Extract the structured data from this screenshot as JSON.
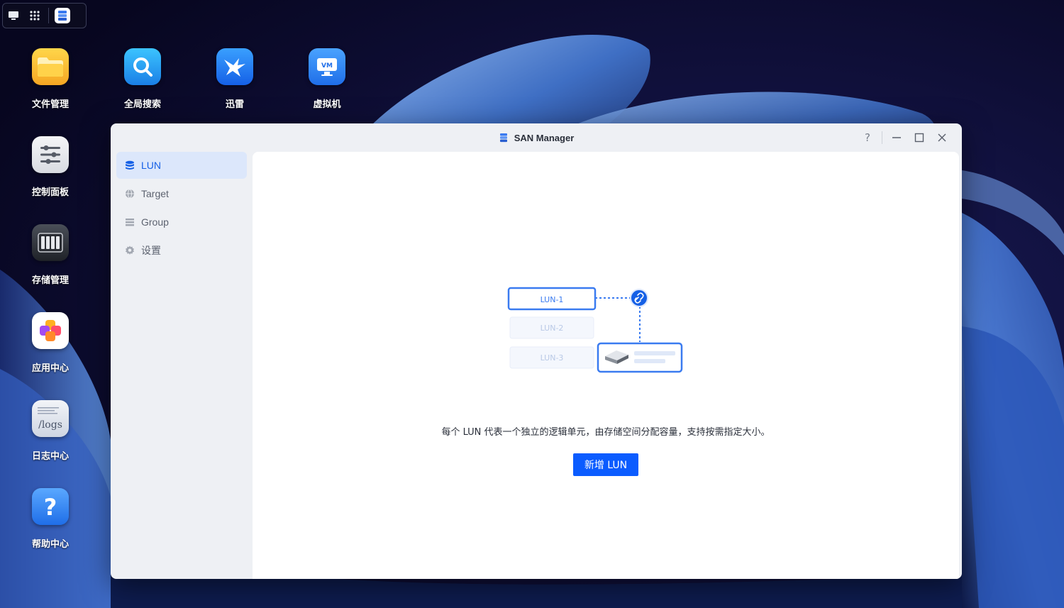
{
  "desktop": {
    "icons": [
      {
        "label": "文件管理"
      },
      {
        "label": "全局搜索"
      },
      {
        "label": "迅雷"
      },
      {
        "label": "虚拟机",
        "badge": "VM"
      },
      {
        "label": "控制面板"
      },
      {
        "label": "存储管理"
      },
      {
        "label": "应用中心"
      },
      {
        "label": "日志中心",
        "badge": "/logs"
      },
      {
        "label": "帮助中心",
        "badge": "?"
      }
    ]
  },
  "taskbar": {
    "items": [
      "desktop-icon",
      "app-grid-icon",
      "san-manager-icon"
    ]
  },
  "window": {
    "title": "SAN Manager",
    "help": "?"
  },
  "sidebar": {
    "items": [
      {
        "label": "LUN",
        "icon": "database-icon",
        "active": true
      },
      {
        "label": "Target",
        "icon": "globe-icon",
        "active": false
      },
      {
        "label": "Group",
        "icon": "list-icon",
        "active": false
      },
      {
        "label": "设置",
        "icon": "gear-icon",
        "active": false
      }
    ]
  },
  "main": {
    "illustration": {
      "lun1": "LUN-1",
      "lun2": "LUN-2",
      "lun3": "LUN-3"
    },
    "description": "每个 LUN 代表一个独立的逻辑单元，由存储空间分配容量，支持按需指定大小。",
    "add_button": "新增 LUN"
  },
  "colors": {
    "accent": "#0b5cff",
    "sidebar_active_bg": "#dce7fb",
    "sidebar_active_text": "#1560e6"
  }
}
